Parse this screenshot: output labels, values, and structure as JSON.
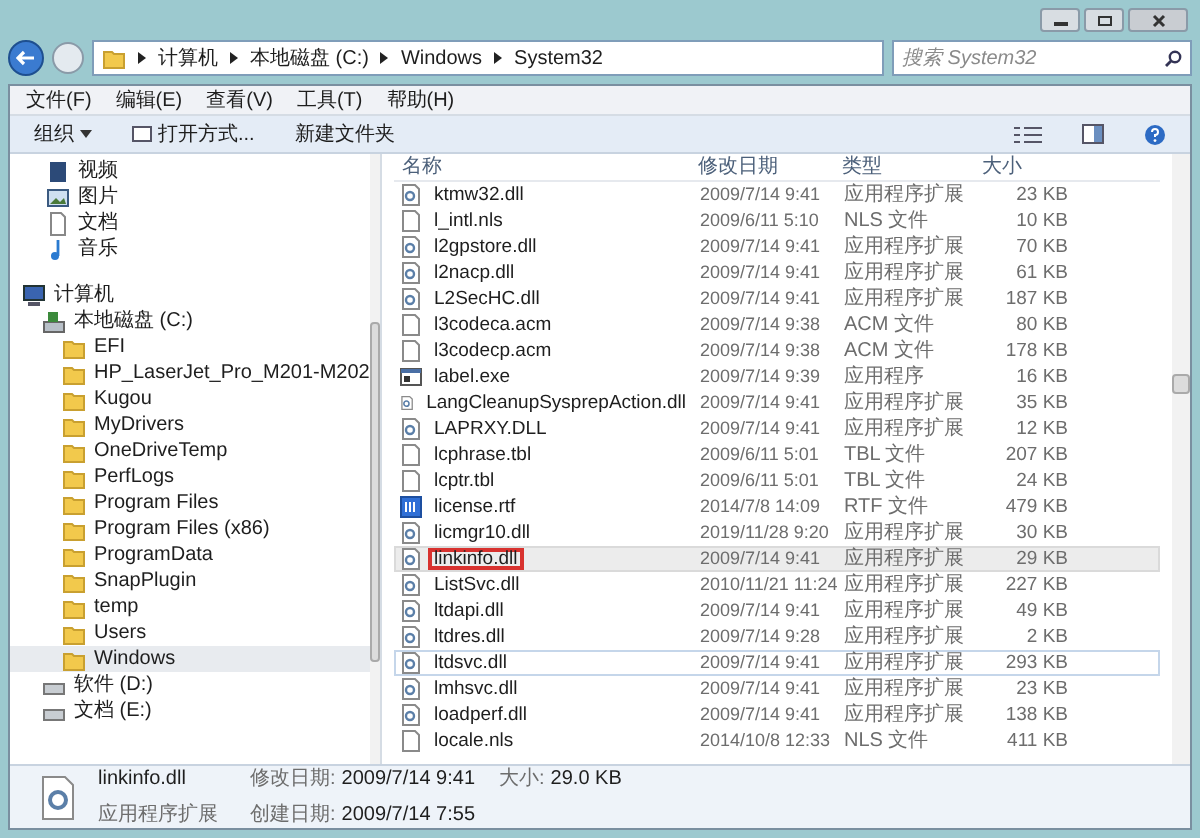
{
  "address_bar": {
    "crumbs": [
      "计算机",
      "本地磁盘 (C:)",
      "Windows",
      "System32"
    ]
  },
  "search": {
    "placeholder": "搜索 System32"
  },
  "menu_bar": [
    "文件(F)",
    "编辑(E)",
    "查看(V)",
    "工具(T)",
    "帮助(H)"
  ],
  "toolbar": [
    {
      "label": "组织",
      "kind": "dropdown"
    },
    {
      "label": "打开方式...",
      "kind": "open"
    },
    {
      "label": "新建文件夹",
      "kind": "plain"
    }
  ],
  "sidebar": {
    "items": [
      {
        "label": "视频",
        "kind": "video",
        "selected": false
      },
      {
        "label": "图片",
        "kind": "picture",
        "selected": false
      },
      {
        "label": "文档",
        "kind": "document",
        "selected": false
      },
      {
        "label": "音乐",
        "kind": "music",
        "selected": false
      },
      {
        "label": "计算机",
        "kind": "computer",
        "selected": false,
        "children": [
          {
            "label": "本地磁盘 (C:)",
            "kind": "drive",
            "selected": false,
            "children": [
              {
                "label": "EFI",
                "kind": "folder",
                "selected": false
              },
              {
                "label": "HP_LaserJet_Pro_M201-M202",
                "kind": "folder",
                "selected": false
              },
              {
                "label": "Kugou",
                "kind": "folder",
                "selected": false
              },
              {
                "label": "MyDrivers",
                "kind": "folder",
                "selected": false
              },
              {
                "label": "OneDriveTemp",
                "kind": "folder",
                "selected": false
              },
              {
                "label": "PerfLogs",
                "kind": "folder",
                "selected": false
              },
              {
                "label": "Program Files",
                "kind": "folder",
                "selected": false
              },
              {
                "label": "Program Files (x86)",
                "kind": "folder",
                "selected": false
              },
              {
                "label": "ProgramData",
                "kind": "folder",
                "selected": false
              },
              {
                "label": "SnapPlugin",
                "kind": "folder",
                "selected": false
              },
              {
                "label": "temp",
                "kind": "folder",
                "selected": false
              },
              {
                "label": "Users",
                "kind": "folder",
                "selected": false
              },
              {
                "label": "Windows",
                "kind": "folder",
                "selected": true
              }
            ]
          },
          {
            "label": "软件 (D:)",
            "kind": "drive2",
            "selected": false
          },
          {
            "label": "文档 (E:)",
            "kind": "drive2",
            "selected": false
          }
        ]
      }
    ]
  },
  "table": {
    "columns": [
      "名称",
      "修改日期",
      "类型",
      "大小"
    ],
    "rows": [
      {
        "name": "ktmw32.dll",
        "date": "2009/7/14 9:41",
        "type": "应用程序扩展",
        "size": "23 KB",
        "kind": "dll",
        "selected": false,
        "hovered": false,
        "annotated": false
      },
      {
        "name": "l_intl.nls",
        "date": "2009/6/11 5:10",
        "type": "NLS 文件",
        "size": "10 KB",
        "kind": "file",
        "selected": false,
        "hovered": false,
        "annotated": false
      },
      {
        "name": "l2gpstore.dll",
        "date": "2009/7/14 9:41",
        "type": "应用程序扩展",
        "size": "70 KB",
        "kind": "dll",
        "selected": false,
        "hovered": false,
        "annotated": false
      },
      {
        "name": "l2nacp.dll",
        "date": "2009/7/14 9:41",
        "type": "应用程序扩展",
        "size": "61 KB",
        "kind": "dll",
        "selected": false,
        "hovered": false,
        "annotated": false
      },
      {
        "name": "L2SecHC.dll",
        "date": "2009/7/14 9:41",
        "type": "应用程序扩展",
        "size": "187 KB",
        "kind": "dll",
        "selected": false,
        "hovered": false,
        "annotated": false
      },
      {
        "name": "l3codeca.acm",
        "date": "2009/7/14 9:38",
        "type": "ACM 文件",
        "size": "80 KB",
        "kind": "file",
        "selected": false,
        "hovered": false,
        "annotated": false
      },
      {
        "name": "l3codecp.acm",
        "date": "2009/7/14 9:38",
        "type": "ACM 文件",
        "size": "178 KB",
        "kind": "file",
        "selected": false,
        "hovered": false,
        "annotated": false
      },
      {
        "name": "label.exe",
        "date": "2009/7/14 9:39",
        "type": "应用程序",
        "size": "16 KB",
        "kind": "exe",
        "selected": false,
        "hovered": false,
        "annotated": false
      },
      {
        "name": "LangCleanupSysprepAction.dll",
        "date": "2009/7/14 9:41",
        "type": "应用程序扩展",
        "size": "35 KB",
        "kind": "dll",
        "selected": false,
        "hovered": false,
        "annotated": false
      },
      {
        "name": "LAPRXY.DLL",
        "date": "2009/7/14 9:41",
        "type": "应用程序扩展",
        "size": "12 KB",
        "kind": "dll",
        "selected": false,
        "hovered": false,
        "annotated": false
      },
      {
        "name": "lcphrase.tbl",
        "date": "2009/6/11 5:01",
        "type": "TBL 文件",
        "size": "207 KB",
        "kind": "file",
        "selected": false,
        "hovered": false,
        "annotated": false
      },
      {
        "name": "lcptr.tbl",
        "date": "2009/6/11 5:01",
        "type": "TBL 文件",
        "size": "24 KB",
        "kind": "file",
        "selected": false,
        "hovered": false,
        "annotated": false
      },
      {
        "name": "license.rtf",
        "date": "2014/7/8 14:09",
        "type": "RTF 文件",
        "size": "479 KB",
        "kind": "rtf",
        "selected": false,
        "hovered": false,
        "annotated": false
      },
      {
        "name": "licmgr10.dll",
        "date": "2019/11/28 9:20",
        "type": "应用程序扩展",
        "size": "30 KB",
        "kind": "dll",
        "selected": false,
        "hovered": false,
        "annotated": false
      },
      {
        "name": "linkinfo.dll",
        "date": "2009/7/14 9:41",
        "type": "应用程序扩展",
        "size": "29 KB",
        "kind": "dll",
        "selected": true,
        "hovered": false,
        "annotated": true
      },
      {
        "name": "ListSvc.dll",
        "date": "2010/11/21 11:24",
        "type": "应用程序扩展",
        "size": "227 KB",
        "kind": "dll",
        "selected": false,
        "hovered": false,
        "annotated": false
      },
      {
        "name": "ltdapi.dll",
        "date": "2009/7/14 9:41",
        "type": "应用程序扩展",
        "size": "49 KB",
        "kind": "dll",
        "selected": false,
        "hovered": false,
        "annotated": false
      },
      {
        "name": "ltdres.dll",
        "date": "2009/7/14 9:28",
        "type": "应用程序扩展",
        "size": "2 KB",
        "kind": "dll",
        "selected": false,
        "hovered": false,
        "annotated": false
      },
      {
        "name": "ltdsvc.dll",
        "date": "2009/7/14 9:41",
        "type": "应用程序扩展",
        "size": "293 KB",
        "kind": "dll",
        "selected": false,
        "hovered": true,
        "annotated": false
      },
      {
        "name": "lmhsvc.dll",
        "date": "2009/7/14 9:41",
        "type": "应用程序扩展",
        "size": "23 KB",
        "kind": "dll",
        "selected": false,
        "hovered": false,
        "annotated": false
      },
      {
        "name": "loadperf.dll",
        "date": "2009/7/14 9:41",
        "type": "应用程序扩展",
        "size": "138 KB",
        "kind": "dll",
        "selected": false,
        "hovered": false,
        "annotated": false
      },
      {
        "name": "locale.nls",
        "date": "2014/10/8 12:33",
        "type": "NLS 文件",
        "size": "411 KB",
        "kind": "file",
        "selected": false,
        "hovered": false,
        "annotated": false
      }
    ]
  },
  "status_bar": {
    "name": "linkinfo.dll",
    "type": "应用程序扩展",
    "fields": [
      {
        "label": "修改日期:",
        "value": "2009/7/14 9:41"
      },
      {
        "label": "大小:",
        "value": "29.0 KB"
      },
      {
        "label": "创建日期:",
        "value": "2009/7/14 7:55"
      }
    ]
  }
}
